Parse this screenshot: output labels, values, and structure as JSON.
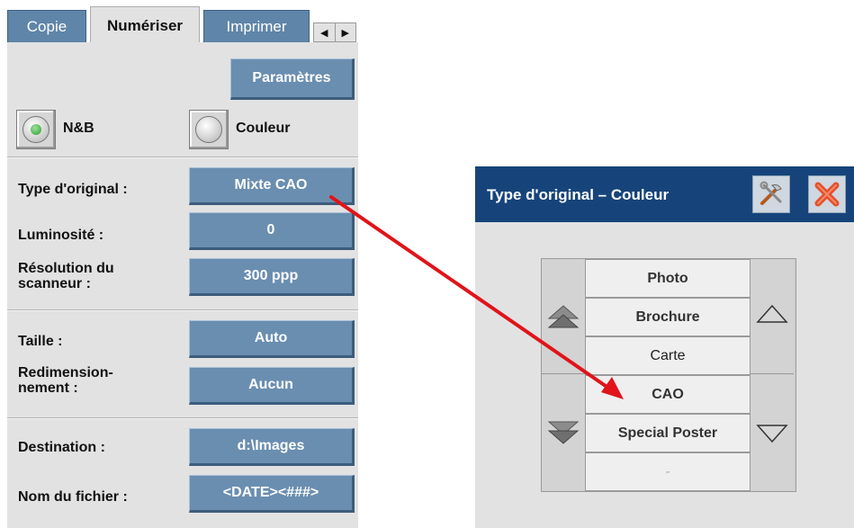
{
  "tabs": [
    {
      "label": "Copie",
      "active": false
    },
    {
      "label": "Numériser",
      "active": true
    },
    {
      "label": "Imprimer",
      "active": false
    }
  ],
  "tab_scroll": {
    "left": "◀",
    "right": "▶"
  },
  "settings_button": "Paramètres",
  "color_mode": {
    "bw_label": "N&B",
    "color_label": "Couleur",
    "selected": "N&B"
  },
  "fields": {
    "original_type": {
      "label": "Type d'original :",
      "value": "Mixte CAO"
    },
    "brightness": {
      "label": "Luminosité :",
      "value": "0"
    },
    "resolution": {
      "label_line1": "Résolution du",
      "label_line2": "scanneur :",
      "value": "300 ppp"
    },
    "size": {
      "label": "Taille :",
      "value": "Auto"
    },
    "resize": {
      "label_line1": "Redimension-",
      "label_line2": "nement  :",
      "value": "Aucun"
    },
    "destination": {
      "label": "Destination :",
      "value": "d:\\Images"
    },
    "filename": {
      "label": "Nom du fichier :",
      "value": "<DATE><###>"
    }
  },
  "dialog": {
    "title": "Type d'original – Couleur",
    "tools_icon": "tools-icon",
    "close_icon": "close-icon",
    "items": [
      "Photo",
      "Brochure",
      "Carte",
      "CAO",
      "Special Poster",
      "-"
    ]
  },
  "colors": {
    "tab_blue": "#5f85a8",
    "button_blue": "#6a8eb0",
    "header_blue": "#16447a",
    "panel_gray": "#e2e2e2",
    "annotation_arrow": "#e0141a"
  }
}
